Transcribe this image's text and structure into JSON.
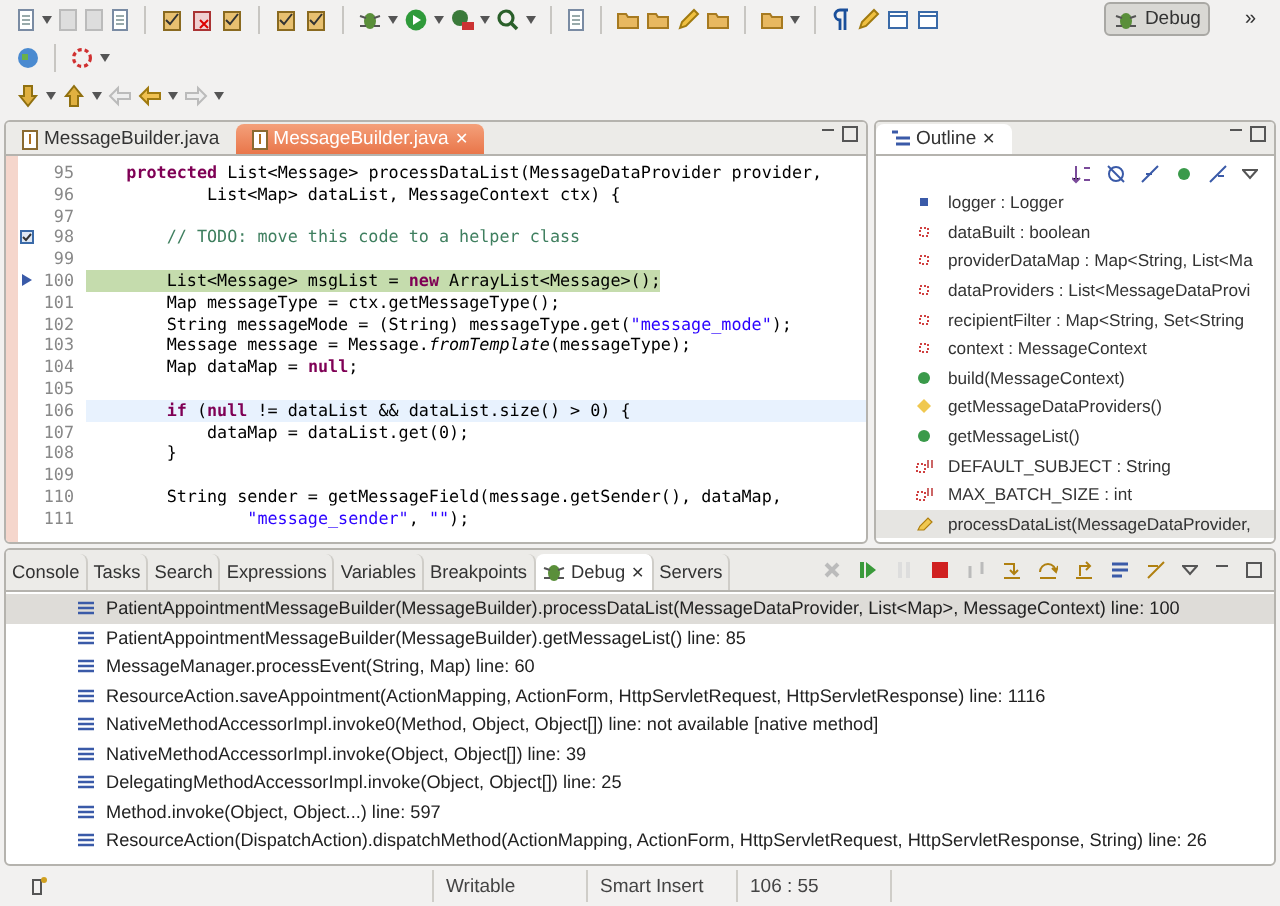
{
  "perspective": {
    "label": "Debug",
    "selected": true,
    "more": "»"
  },
  "editor": {
    "tabs": [
      {
        "label": "MessageBuilder.java",
        "selected": false
      },
      {
        "label": "MessageBuilder.java",
        "selected": true,
        "close": "✕"
      }
    ],
    "lines": [
      {
        "number": "95",
        "kind": "normal",
        "segments": [
          {
            "kind": "keyword",
            "text": "    protected"
          },
          {
            "kind": "plain",
            "text": " List<Message> processDataList(MessageDataProvider provider,"
          }
        ]
      },
      {
        "number": "96",
        "kind": "normal",
        "segments": [
          {
            "kind": "plain",
            "text": "            List<Map> dataList, MessageContext ctx) {"
          }
        ]
      },
      {
        "number": "97"
      },
      {
        "number": "98",
        "kind": "normal",
        "task": true,
        "segments": [
          {
            "kind": "comment",
            "text": "        // TODO: move this code to a helper class"
          }
        ]
      },
      {
        "number": "99"
      },
      {
        "number": "100",
        "kind": "current",
        "pointer": true,
        "segments": [
          {
            "kind": "plain",
            "text": "        List<Message> msgList = "
          },
          {
            "kind": "keyword",
            "text": "new"
          },
          {
            "kind": "plain",
            "text": " ArrayList<Message>();"
          }
        ]
      },
      {
        "number": "101",
        "kind": "normal",
        "segments": [
          {
            "kind": "plain",
            "text": "        Map messageType = ctx.getMessageType();"
          }
        ]
      },
      {
        "number": "102",
        "kind": "normal",
        "segments": [
          {
            "kind": "plain",
            "text": "        String messageMode = (String) messageType.get("
          },
          {
            "kind": "string",
            "text": "\"message_mode\""
          },
          {
            "kind": "plain",
            "text": ");"
          }
        ]
      },
      {
        "number": "103",
        "kind": "normal",
        "segments": [
          {
            "kind": "plain",
            "text": "        Message message = Message."
          },
          {
            "kind": "italic",
            "text": "fromTemplate"
          },
          {
            "kind": "plain",
            "text": "(messageType);"
          }
        ]
      },
      {
        "number": "104",
        "kind": "normal",
        "segments": [
          {
            "kind": "plain",
            "text": "        Map dataMap = "
          },
          {
            "kind": "keyword",
            "text": "null"
          },
          {
            "kind": "plain",
            "text": ";"
          }
        ]
      },
      {
        "number": "105"
      },
      {
        "number": "106",
        "kind": "cursor",
        "segments": [
          {
            "kind": "keyword",
            "text": "        if"
          },
          {
            "kind": "plain",
            "text": " ("
          },
          {
            "kind": "keyword",
            "text": "null"
          },
          {
            "kind": "plain",
            "text": " != dataList && dataList.size() > 0) {"
          }
        ]
      },
      {
        "number": "107",
        "kind": "normal",
        "segments": [
          {
            "kind": "plain",
            "text": "            dataMap = dataList.get(0);"
          }
        ]
      },
      {
        "number": "108",
        "kind": "normal",
        "segments": [
          {
            "kind": "plain",
            "text": "        }"
          }
        ]
      },
      {
        "number": "109"
      },
      {
        "number": "110",
        "kind": "normal",
        "segments": [
          {
            "kind": "plain",
            "text": "        String sender = getMessageField(message.getSender(), dataMap,"
          }
        ]
      },
      {
        "number": "111",
        "kind": "normal",
        "segments": [
          {
            "kind": "string",
            "text": "                \"message_sender\""
          },
          {
            "kind": "plain",
            "text": ", "
          },
          {
            "kind": "string",
            "text": "\"\""
          },
          {
            "kind": "plain",
            "text": ");"
          }
        ]
      }
    ]
  },
  "outline": {
    "title": "Outline",
    "close": "✕",
    "items": [
      {
        "label": "logger : Logger",
        "kind": "field-default",
        "selected": false
      },
      {
        "label": "dataBuilt : boolean",
        "kind": "field-private",
        "selected": false
      },
      {
        "label": "providerDataMap : Map<String, List<Ma",
        "kind": "field-private",
        "selected": false
      },
      {
        "label": "dataProviders : List<MessageDataProvi",
        "kind": "field-private",
        "selected": false
      },
      {
        "label": "recipientFilter : Map<String, Set<String",
        "kind": "field-private",
        "selected": false
      },
      {
        "label": "context : MessageContext",
        "kind": "field-private",
        "selected": false
      },
      {
        "label": "build(MessageContext)",
        "kind": "method-public",
        "selected": false
      },
      {
        "label": "getMessageDataProviders()",
        "kind": "method-protected",
        "selected": false
      },
      {
        "label": "getMessageList()",
        "kind": "method-public",
        "selected": false
      },
      {
        "label": "DEFAULT_SUBJECT : String",
        "kind": "constant",
        "selected": false
      },
      {
        "label": "MAX_BATCH_SIZE : int",
        "kind": "constant",
        "selected": false
      },
      {
        "label": "processDataList(MessageDataProvider,",
        "kind": "method-edited",
        "selected": true
      }
    ]
  },
  "bottom": {
    "tabs": [
      {
        "label": "Console",
        "selected": false
      },
      {
        "label": "Tasks",
        "selected": false
      },
      {
        "label": "Search",
        "selected": false
      },
      {
        "label": "Expressions",
        "selected": false
      },
      {
        "label": "Variables",
        "selected": false
      },
      {
        "label": "Breakpoints",
        "selected": false
      },
      {
        "label": "Debug",
        "selected": true,
        "close": "✕"
      },
      {
        "label": "Servers",
        "selected": false
      }
    ],
    "frames": [
      {
        "label": "PatientAppointmentMessageBuilder(MessageBuilder).processDataList(MessageDataProvider, List<Map>, MessageContext) line: 100",
        "selected": true
      },
      {
        "label": "PatientAppointmentMessageBuilder(MessageBuilder).getMessageList() line: 85",
        "selected": false
      },
      {
        "label": "MessageManager.processEvent(String, Map) line: 60",
        "selected": false
      },
      {
        "label": "ResourceAction.saveAppointment(ActionMapping, ActionForm, HttpServletRequest, HttpServletResponse) line: 1116",
        "selected": false
      },
      {
        "label": "NativeMethodAccessorImpl.invoke0(Method, Object, Object[]) line: not available [native method]",
        "selected": false
      },
      {
        "label": "NativeMethodAccessorImpl.invoke(Object, Object[]) line: 39",
        "selected": false
      },
      {
        "label": "DelegatingMethodAccessorImpl.invoke(Object, Object[]) line: 25",
        "selected": false
      },
      {
        "label": "Method.invoke(Object, Object...) line: 597",
        "selected": false
      },
      {
        "label": "ResourceAction(DispatchAction).dispatchMethod(ActionMapping, ActionForm, HttpServletRequest, HttpServletResponse, String) line: 26",
        "selected": false
      }
    ]
  },
  "status_bar": {
    "mode": "Writable",
    "insert": "Smart Insert",
    "position": "106 : 55"
  }
}
